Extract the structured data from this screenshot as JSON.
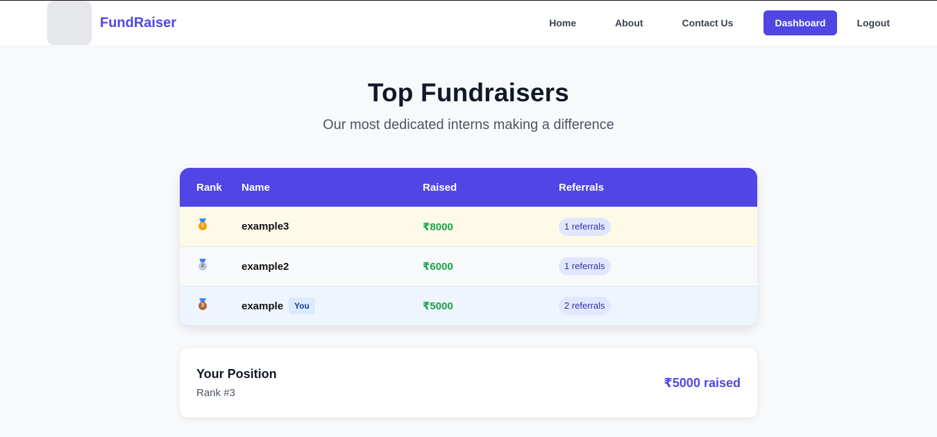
{
  "nav": {
    "brand": "FundRaiser",
    "links": {
      "home": "Home",
      "about": "About",
      "contact": "Contact Us",
      "dashboard": "Dashboard",
      "logout": "Logout"
    }
  },
  "hero": {
    "title": "Top Fundraisers",
    "subtitle": "Our most dedicated interns making a difference"
  },
  "table": {
    "headers": {
      "rank": "Rank",
      "name": "Name",
      "raised": "Raised",
      "referrals": "Referrals"
    },
    "rows": [
      {
        "medal": "gold-medal-icon",
        "rank_num": "1",
        "name": "example3",
        "raised": "₹8000",
        "referrals": "1 referrals"
      },
      {
        "medal": "silver-medal-icon",
        "rank_num": "2",
        "name": "example2",
        "raised": "₹6000",
        "referrals": "1 referrals"
      },
      {
        "medal": "bronze-medal-icon",
        "rank_num": "3",
        "name": "example",
        "you": "You",
        "raised": "₹5000",
        "referrals": "2 referrals"
      }
    ]
  },
  "position": {
    "title": "Your Position",
    "rank": "Rank #3",
    "raised": "₹5000 raised"
  },
  "colors": {
    "accent": "#4f46e5",
    "money": "#16a34a",
    "gold": "#f59e0b",
    "silver": "#a5a7c4",
    "bronze": "#b4673b"
  }
}
